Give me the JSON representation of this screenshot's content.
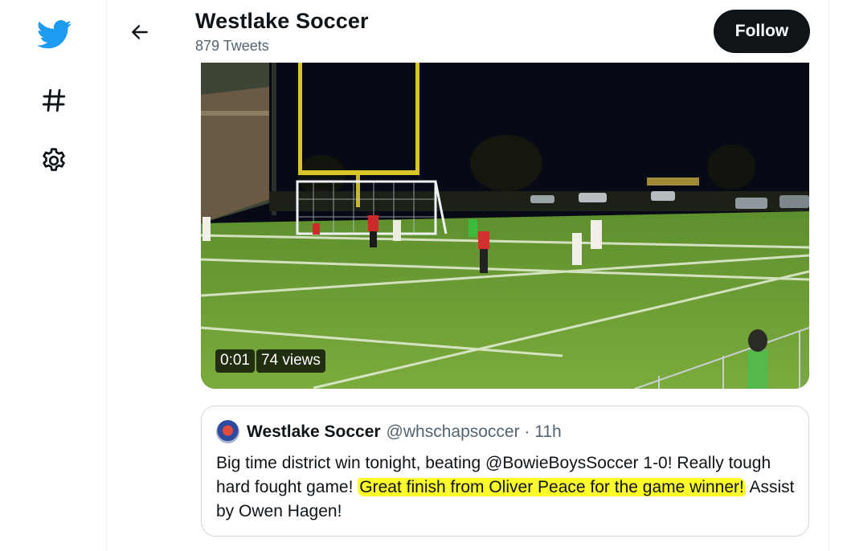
{
  "nav": {
    "icons": [
      "twitter-bird-icon",
      "hashtag-icon",
      "gear-icon"
    ]
  },
  "header": {
    "title": "Westlake Soccer",
    "subtitle": "879 Tweets",
    "follow_label": "Follow"
  },
  "video": {
    "time": "0:01",
    "views": "74 views"
  },
  "quoted_tweet": {
    "name": "Westlake Soccer",
    "handle_time": "@whschapsoccer · 11h",
    "text_plain": "Big time district win tonight, beating @BowieBoysSoccer 1-0! Really tough hard fought game! ",
    "text_highlight": "Great finish from Oliver Peace for the game winner!",
    "text_end": " Assist by Owen Hagen!"
  },
  "colors": {
    "brand_blue": "#1d9bf0",
    "highlight": "#fdfd2a",
    "follow_bg": "#0f1419"
  }
}
